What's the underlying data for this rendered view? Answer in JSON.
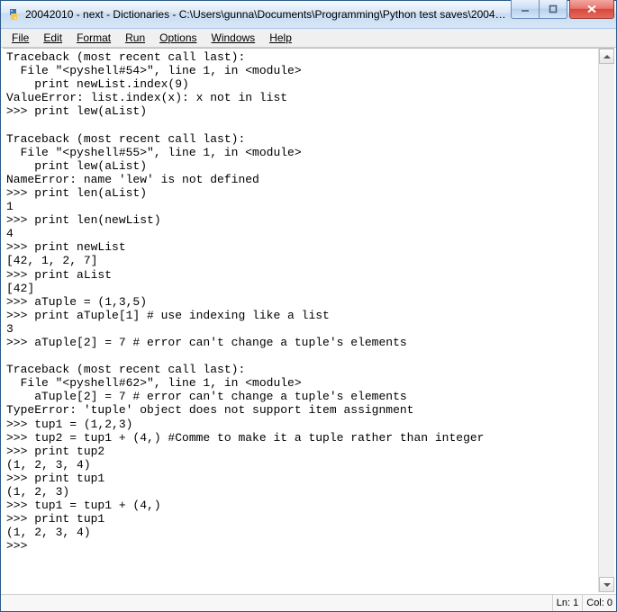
{
  "window": {
    "title": "20042010 - next - Dictionaries - C:\\Users\\gunna\\Documents\\Programming\\Python test saves\\20042..."
  },
  "menubar": {
    "items": [
      "File",
      "Edit",
      "Format",
      "Run",
      "Options",
      "Windows",
      "Help"
    ]
  },
  "editor": {
    "content": "Traceback (most recent call last):\n  File \"<pyshell#54>\", line 1, in <module>\n    print newList.index(9)\nValueError: list.index(x): x not in list\n>>> print lew(aList)\n\nTraceback (most recent call last):\n  File \"<pyshell#55>\", line 1, in <module>\n    print lew(aList)\nNameError: name 'lew' is not defined\n>>> print len(aList)\n1\n>>> print len(newList)\n4\n>>> print newList\n[42, 1, 2, 7]\n>>> print aList\n[42]\n>>> aTuple = (1,3,5)\n>>> print aTuple[1] # use indexing like a list\n3\n>>> aTuple[2] = 7 # error can't change a tuple's elements\n\nTraceback (most recent call last):\n  File \"<pyshell#62>\", line 1, in <module>\n    aTuple[2] = 7 # error can't change a tuple's elements\nTypeError: 'tuple' object does not support item assignment\n>>> tup1 = (1,2,3)\n>>> tup2 = tup1 + (4,) #Comme to make it a tuple rather than integer\n>>> print tup2\n(1, 2, 3, 4)\n>>> print tup1\n(1, 2, 3)\n>>> tup1 = tup1 + (4,)\n>>> print tup1\n(1, 2, 3, 4)\n>>> "
  },
  "status": {
    "line": "Ln: 1",
    "col": "Col: 0"
  }
}
